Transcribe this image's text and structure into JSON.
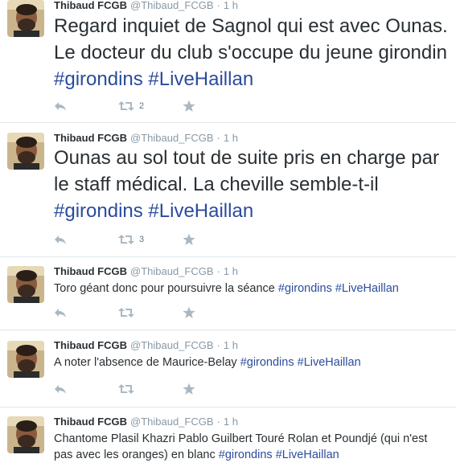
{
  "tweets": [
    {
      "fullname": "Thibaud FCGB",
      "screenname": "@Thibaud_FCGB",
      "separator": "·",
      "time": "1 h",
      "text": "Regard inquiet de Sagnol qui est avec Ounas. Le docteur du club s'occupe du jeune girondin",
      "hashtags": [
        "#girondins",
        "#LiveHaillan"
      ],
      "retweet_count": "2"
    },
    {
      "fullname": "Thibaud FCGB",
      "screenname": "@Thibaud_FCGB",
      "separator": "·",
      "time": "1 h",
      "text": "Ounas au sol tout de suite pris en charge par le staff médical. La cheville semble-t-il",
      "hashtags": [
        "#girondins",
        "#LiveHaillan"
      ],
      "retweet_count": "3"
    },
    {
      "fullname": "Thibaud FCGB",
      "screenname": "@Thibaud_FCGB",
      "separator": "·",
      "time": "1 h",
      "text": "Toro géant donc pour poursuivre la séance",
      "hashtags": [
        "#girondins",
        "#LiveHaillan"
      ],
      "retweet_count": ""
    },
    {
      "fullname": "Thibaud FCGB",
      "screenname": "@Thibaud_FCGB",
      "separator": "·",
      "time": "1 h",
      "text": "A noter l'absence de Maurice-Belay",
      "hashtags": [
        "#girondins",
        "#LiveHaillan"
      ],
      "retweet_count": ""
    },
    {
      "fullname": "Thibaud FCGB",
      "screenname": "@Thibaud_FCGB",
      "separator": "·",
      "time": "1 h",
      "text": "Chantome Plasil Khazri Pablo Guilbert Touré Rolan et Poundjé (qui n'est pas avec les oranges) en blanc",
      "hashtags": [
        "#girondins",
        "#LiveHaillan"
      ],
      "retweet_count": ""
    }
  ],
  "icons": {
    "reply": "reply-icon",
    "retweet": "retweet-icon",
    "favorite": "star-icon"
  },
  "colors": {
    "hashtag": "#2b4c9c",
    "meta_gray": "#8899a6",
    "icon_gray": "#aab8c2",
    "divider": "#e1e8ed"
  }
}
